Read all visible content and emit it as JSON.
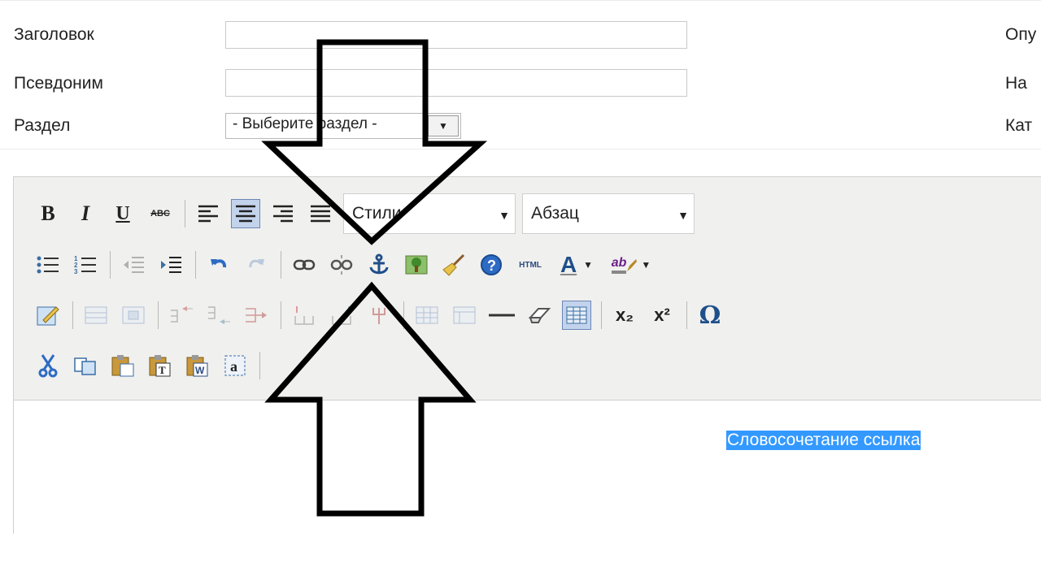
{
  "form": {
    "title_label": "Заголовок",
    "alias_label": "Псевдоним",
    "section_label": "Раздел",
    "section_select_value": "- Выберите раздел -",
    "right_label_1": "Опу",
    "right_label_2": "На",
    "right_label_3": "Кат"
  },
  "toolbar": {
    "bold": "B",
    "italic": "I",
    "underline": "U",
    "strikethrough": "ABC",
    "styles_value": "Стили",
    "format_value": "Абзац",
    "html_label": "HTML",
    "font_color_letter": "A",
    "highlight_label": "ab",
    "subscript": "x₂",
    "superscript": "x²",
    "special_char": "Ω"
  },
  "content": {
    "selected_text": "Словосочетание ссылка"
  },
  "colors": {
    "selection": "#3399ff",
    "toolbar_bg": "#f0f0ee",
    "active_button": "#c3d3ec"
  }
}
